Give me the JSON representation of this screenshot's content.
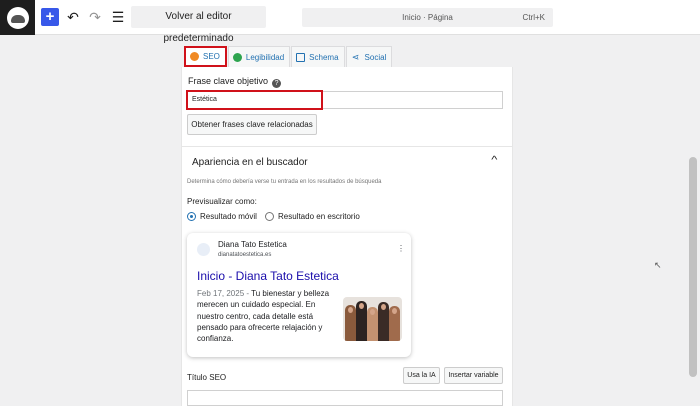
{
  "toolbar": {
    "back_label": "Volver al editor predeterminado",
    "command_title": "Inicio · Página",
    "command_shortcut": "Ctrl+K"
  },
  "tabs": [
    {
      "label": "SEO",
      "icon": "orange-face-icon",
      "active": true
    },
    {
      "label": "Legibilidad",
      "icon": "green-face-icon"
    },
    {
      "label": "Schema",
      "icon": "grid-icon"
    },
    {
      "label": "Social",
      "icon": "share-icon"
    }
  ],
  "focus_keyphrase": {
    "label": "Frase clave objetivo",
    "value": "Estética",
    "related_button": "Obtener frases clave relacionadas"
  },
  "search_appearance": {
    "title": "Apariencia en el buscador",
    "description": "Determina cómo debería verse tu entrada en los resultados de búsqueda",
    "preview_label": "Previsualizar como:",
    "options": [
      "Resultado móvil",
      "Resultado en escritorio"
    ],
    "selected": "Resultado móvil"
  },
  "google_preview": {
    "site_name": "Diana Tato Estetica",
    "site_url": "dianatatoestetica.es",
    "title": "Inicio - Diana Tato Estetica",
    "date": "Feb 17, 2025",
    "separator": "-",
    "description": "Tu bienestar y belleza merecen un cuidado especial. En nuestro centro, cada detalle está pensado para ofrecerte relajación y confianza."
  },
  "seo_title": {
    "label": "Título SEO",
    "ai_button": "Usa la IA",
    "variable_button": "Insertar variable"
  },
  "colors": {
    "accent": "#3858e9",
    "link": "#2271b1",
    "highlight": "#d0111a",
    "serp_title": "#1a0dab"
  }
}
